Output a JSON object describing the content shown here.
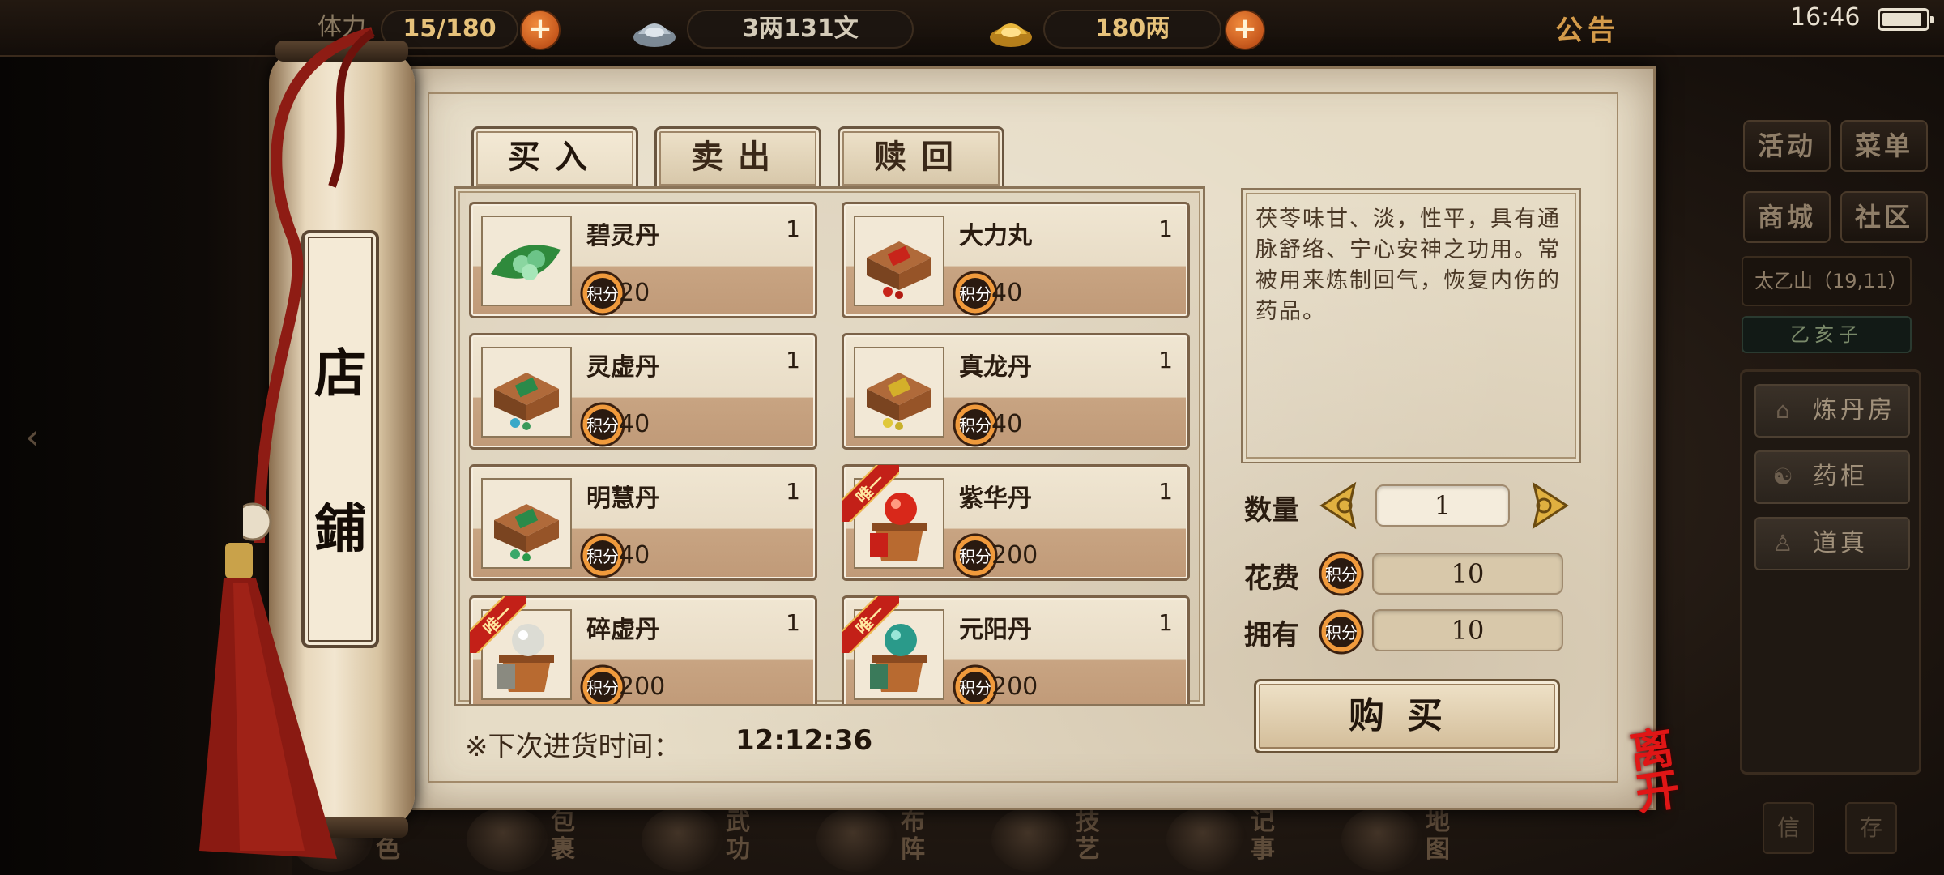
{
  "topbar": {
    "stamina_label": "体力",
    "stamina_value": "15/180",
    "silver_value": "3两131文",
    "gold_value": "180两",
    "notice_label": "公告",
    "clock": "16:46"
  },
  "right_panel": {
    "buttons": [
      "活动",
      "菜单",
      "商城",
      "社区"
    ],
    "location": "太乙山（19,11）",
    "location_sub": "乙亥子",
    "side_items": [
      "炼丹房",
      "药柜",
      "道真"
    ],
    "corner_buttons": [
      "信",
      "存"
    ]
  },
  "bottom_nav": [
    "角色",
    "包裹",
    "武功",
    "布阵",
    "技艺",
    "记事",
    "地图"
  ],
  "shop": {
    "title_chars": [
      "店",
      "鋪"
    ],
    "tabs": [
      "买入",
      "卖出",
      "赎回"
    ],
    "active_tab": "买入",
    "currency_icon_text": "积分",
    "items": [
      {
        "name": "碧灵丹",
        "qty": "1",
        "price": "20",
        "unique": false,
        "icon": "green-leaf-pill-icon"
      },
      {
        "name": "大力丸",
        "qty": "1",
        "price": "40",
        "unique": false,
        "icon": "red-pill-box-icon"
      },
      {
        "name": "灵虚丹",
        "qty": "1",
        "price": "40",
        "unique": false,
        "icon": "green-pill-box-icon"
      },
      {
        "name": "真龙丹",
        "qty": "1",
        "price": "40",
        "unique": false,
        "icon": "yellow-pill-box-icon"
      },
      {
        "name": "明慧丹",
        "qty": "1",
        "price": "40",
        "unique": false,
        "icon": "green-pill-box-icon"
      },
      {
        "name": "紫华丹",
        "qty": "1",
        "price": "200",
        "unique": true,
        "icon": "red-orb-stand-icon"
      },
      {
        "name": "碎虚丹",
        "qty": "1",
        "price": "200",
        "unique": true,
        "icon": "white-orb-stand-icon"
      },
      {
        "name": "元阳丹",
        "qty": "1",
        "price": "200",
        "unique": true,
        "icon": "teal-orb-stand-icon"
      }
    ],
    "unique_tag": "唯一",
    "restock_label": "※下次进货时间：",
    "restock_time": "12:12:36",
    "description": "茯苓味甘、淡，性平，具有通脉舒络、宁心安神之功用。常被用来炼制回气，恢复内伤的药品。",
    "quantity_label": "数量",
    "quantity_value": "1",
    "cost_label": "花费",
    "cost_value": "10",
    "owned_label": "拥有",
    "owned_value": "10",
    "buy_label": "购买",
    "leave_label": "离开"
  },
  "colors": {
    "accent_orange": "#e07a2a",
    "gold_text": "#e7c27a",
    "leave_red": "#e01616",
    "parchment": "#e6dcc6"
  }
}
